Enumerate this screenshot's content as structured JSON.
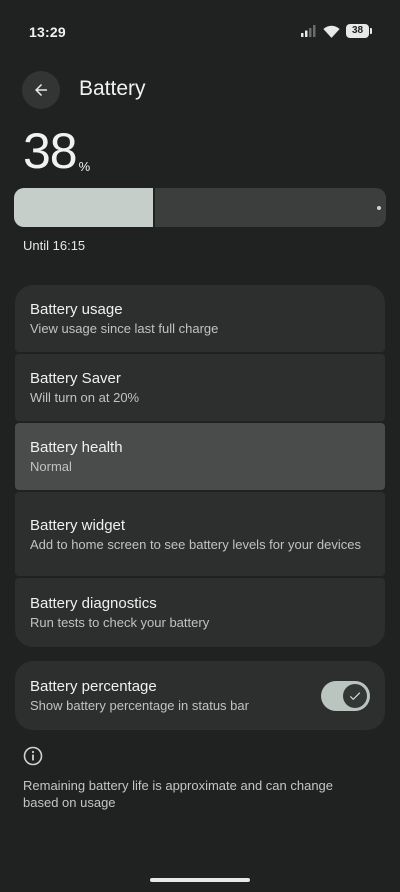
{
  "status_bar": {
    "time": "13:29",
    "battery_level": "38"
  },
  "header": {
    "title": "Battery",
    "back_icon": "arrow-left-icon"
  },
  "battery": {
    "level": "38",
    "unit": "%",
    "fill_fraction": 0.38,
    "until": "Until 16:15"
  },
  "items": [
    {
      "title": "Battery usage",
      "subtitle": "View usage since last full charge"
    },
    {
      "title": "Battery Saver",
      "subtitle": "Will turn on at 20%"
    },
    {
      "title": "Battery health",
      "subtitle": "Normal"
    },
    {
      "title": "Battery widget",
      "subtitle": "Add to home screen to see battery levels for your devices"
    },
    {
      "title": "Battery diagnostics",
      "subtitle": "Run tests to check your battery"
    }
  ],
  "percentage_toggle": {
    "title": "Battery percentage",
    "subtitle": "Show battery percentage in status bar",
    "enabled": true
  },
  "footnote": "Remaining battery life is approximate and can change based on usage",
  "colors": {
    "background": "#202121",
    "card": "#2d2f2e",
    "selected_card": "#4a4c4b",
    "bar_fill": "#c5cec9",
    "switch_track": "#bac5bf"
  }
}
